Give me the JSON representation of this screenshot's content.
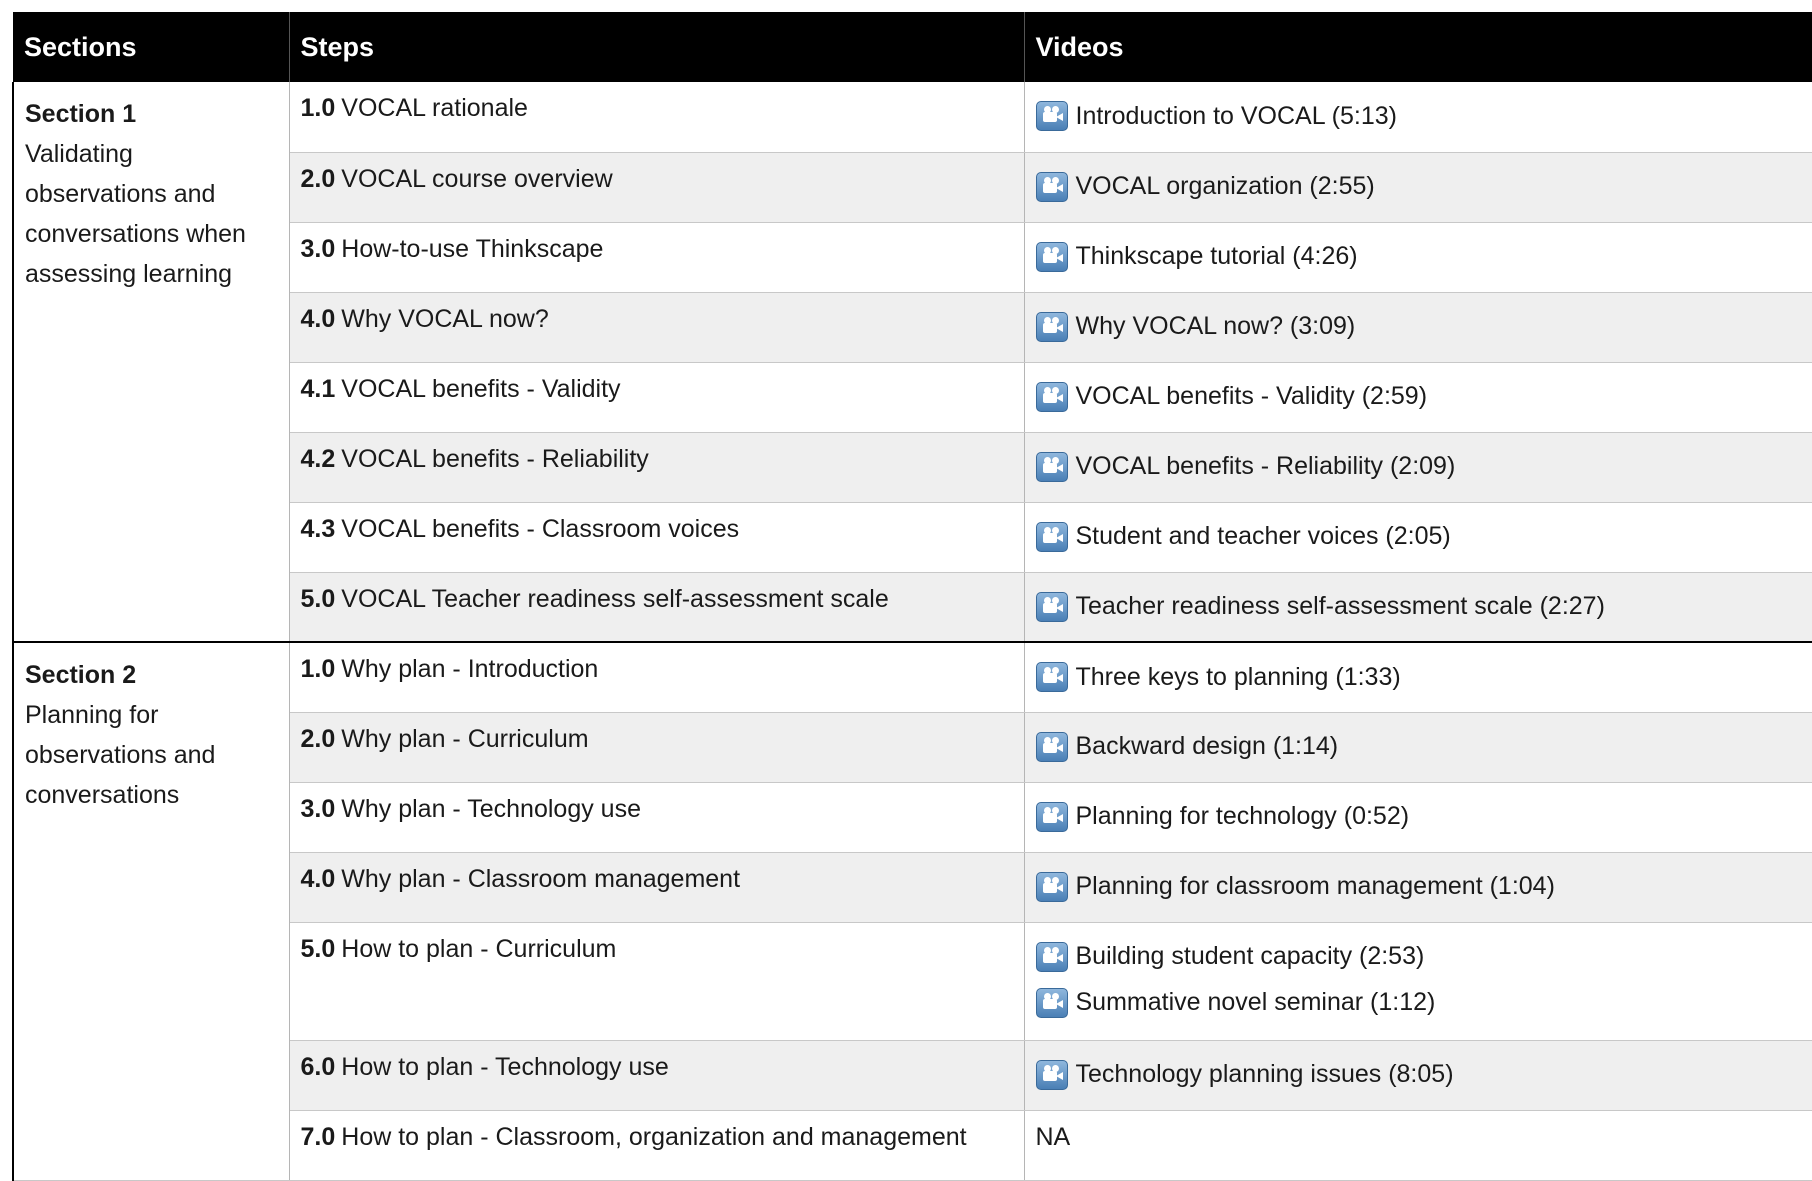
{
  "headers": [
    "Sections",
    "Steps",
    "Videos"
  ],
  "sections": [
    {
      "title": "Section 1",
      "subtitle": "Validating observations and conversations when assessing learning",
      "steps": [
        {
          "num": "1.0",
          "label": "VOCAL rationale",
          "videos": [
            "Introduction to VOCAL (5:13)"
          ]
        },
        {
          "num": "2.0",
          "label": "VOCAL course overview",
          "videos": [
            "VOCAL organization (2:55)"
          ]
        },
        {
          "num": "3.0",
          "label": "How-to-use Thinkscape",
          "videos": [
            "Thinkscape tutorial (4:26)"
          ]
        },
        {
          "num": "4.0",
          "label": "Why VOCAL now?",
          "videos": [
            "Why VOCAL now? (3:09)"
          ]
        },
        {
          "num": "4.1",
          "label": "VOCAL benefits - Validity",
          "videos": [
            "VOCAL benefits - Validity (2:59)"
          ]
        },
        {
          "num": "4.2",
          "label": "VOCAL benefits - Reliability",
          "videos": [
            "VOCAL benefits - Reliability (2:09)"
          ]
        },
        {
          "num": "4.3",
          "label": "VOCAL benefits - Classroom voices",
          "videos": [
            "Student and teacher voices (2:05)"
          ]
        },
        {
          "num": "5.0",
          "label": "VOCAL Teacher readiness self-assessment scale",
          "videos": [
            "Teacher readiness self-assessment scale (2:27)"
          ]
        }
      ]
    },
    {
      "title": "Section 2",
      "subtitle": "Planning for observations and conversations",
      "steps": [
        {
          "num": "1.0",
          "label": "Why plan - Introduction",
          "videos": [
            "Three keys to planning  (1:33)"
          ]
        },
        {
          "num": "2.0",
          "label": "Why plan - Curriculum",
          "videos": [
            "Backward design (1:14)"
          ]
        },
        {
          "num": "3.0",
          "label": "Why plan - Technology use",
          "videos": [
            "Planning for technology (0:52)"
          ]
        },
        {
          "num": "4.0",
          "label": "Why plan - Classroom management",
          "videos": [
            "Planning for classroom management (1:04)"
          ]
        },
        {
          "num": "5.0",
          "label": "How to plan - Curriculum",
          "videos": [
            "Building student capacity (2:53)",
            "Summative novel seminar (1:12)"
          ]
        },
        {
          "num": "6.0",
          "label": "How to plan - Technology use",
          "videos": [
            "Technology planning issues (8:05)"
          ]
        },
        {
          "num": "7.0",
          "label": "How to plan - Classroom, organization and management",
          "videos": [],
          "na": "NA"
        }
      ]
    }
  ]
}
